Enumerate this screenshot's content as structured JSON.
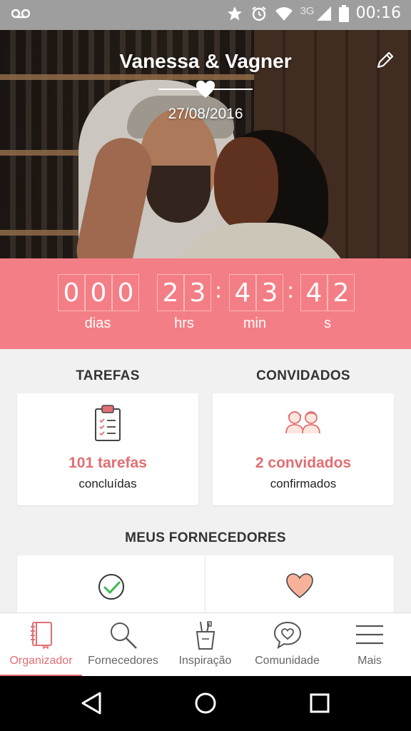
{
  "status_bar": {
    "time": "00:16",
    "network": "3G",
    "icons": [
      "voicemail-icon",
      "star-icon",
      "alarm-icon",
      "wifi-icon",
      "signal-icon",
      "battery-icon"
    ]
  },
  "hero": {
    "couple_names": "Vanessa & Vagner",
    "wedding_date": "27/08/2016"
  },
  "countdown": {
    "days_digits": [
      "0",
      "0",
      "0"
    ],
    "hours_digits": [
      "2",
      "3"
    ],
    "minutes_digits": [
      "4",
      "3"
    ],
    "seconds_digits": [
      "4",
      "2"
    ],
    "separator": ":",
    "labels": {
      "days": "dias",
      "hours": "hrs",
      "minutes": "min",
      "seconds": "s"
    }
  },
  "tasks": {
    "title": "TAREFAS",
    "count": "101 tarefas",
    "caption": "concluídas"
  },
  "guests": {
    "title": "CONVIDADOS",
    "count": "2 convidados",
    "caption": "confirmados"
  },
  "vendors": {
    "title": "MEUS FORNECEDORES"
  },
  "tabs": [
    {
      "label": "Organizador",
      "icon": "notebook-icon",
      "active": true
    },
    {
      "label": "Fornecedores",
      "icon": "search-icon",
      "active": false
    },
    {
      "label": "Inspiração",
      "icon": "brushes-cup-icon",
      "active": false
    },
    {
      "label": "Comunidade",
      "icon": "chat-heart-icon",
      "active": false
    },
    {
      "label": "Mais",
      "icon": "menu-icon",
      "active": false
    }
  ],
  "colors": {
    "accent": "#e26e72",
    "countdown_bg": "#f47e85",
    "status_bar": "#9e9e9e"
  }
}
